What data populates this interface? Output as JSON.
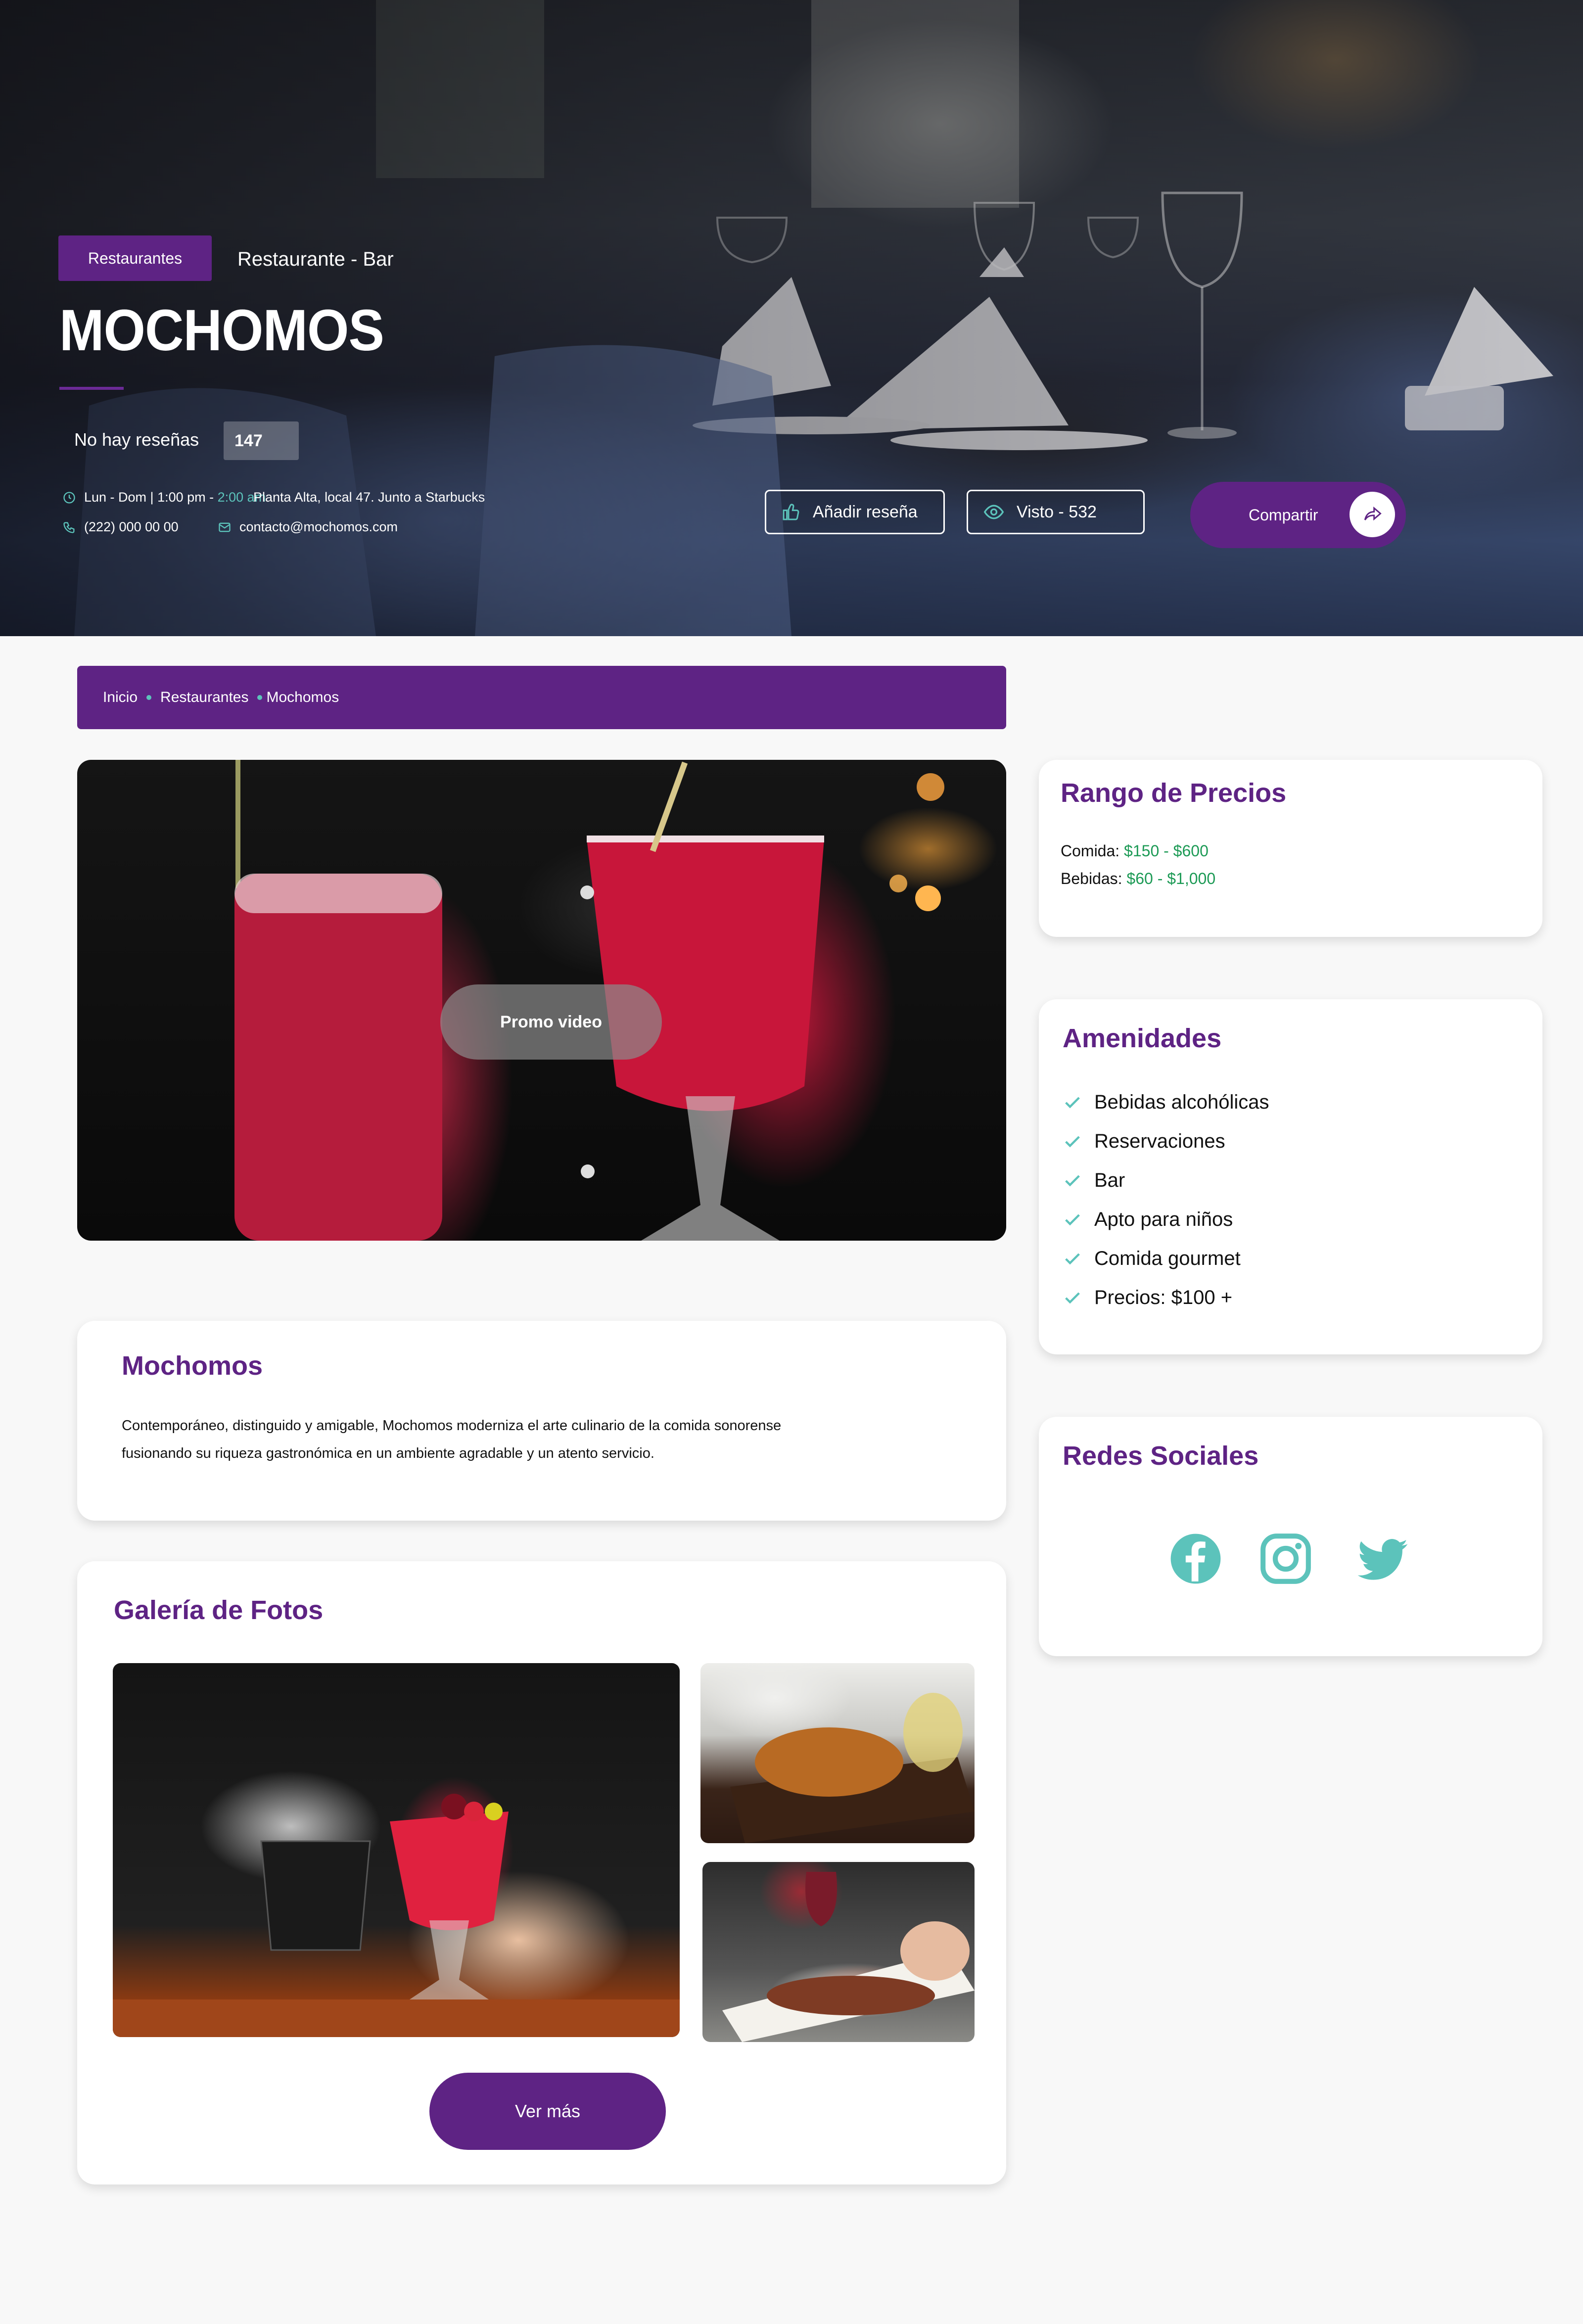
{
  "hero": {
    "category_badge": "Restaurantes",
    "subcategory": "Restaurante - Bar",
    "title": "MOCHOMOS",
    "reviews_text": "No hay reseñas",
    "reviews_count": "147",
    "hours_prefix": "Lun - Dom | 1:00 pm - ",
    "hours_suffix": "2:00 am",
    "address": "Planta Alta, local 47. Junto a Starbucks",
    "phone": "(222) 000 00 00",
    "email": "contacto@mochomos.com",
    "add_review_label": "Añadir reseña",
    "views_label": "Visto - 532",
    "share_label": "Compartir"
  },
  "breadcrumb": {
    "items": [
      "Inicio",
      "Restaurantes",
      "Mochomos"
    ]
  },
  "video": {
    "play_label": "Promo video"
  },
  "about": {
    "title": "Mochomos",
    "line1": "Contemporáneo, distinguido y amigable, Mochomos moderniza el arte culinario de la comida sonorense",
    "line2": "fusionando su riqueza gastronómica en un ambiente agradable y un atento servicio."
  },
  "gallery": {
    "title": "Galería de Fotos",
    "more_label": "Ver más"
  },
  "prices": {
    "title": "Rango de Precios",
    "food_label": "Comida:",
    "food_value": "$150 - $600",
    "drinks_label": "Bebidas:",
    "drinks_value": "$60 - $1,000"
  },
  "amenities": {
    "title": "Amenidades",
    "items": [
      "Bebidas alcohólicas",
      "Reservaciones",
      "Bar",
      "Apto para niños",
      "Comida gourmet",
      "Precios: $100 +"
    ]
  },
  "social": {
    "title": "Redes Sociales",
    "icons": [
      "facebook-icon",
      "instagram-icon",
      "twitter-icon"
    ]
  },
  "colors": {
    "brand_purple": "#5e2384",
    "accent_teal": "#5cc3bb",
    "price_green": "#1c9a55"
  }
}
